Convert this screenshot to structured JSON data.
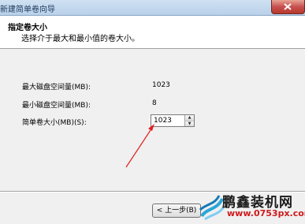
{
  "window": {
    "title": "新建简单卷向导"
  },
  "header": {
    "title": "指定卷大小",
    "subtitle": "选择介于最大和最小值的卷大小。"
  },
  "fields": {
    "max_label": "最大磁盘空间量(MB):",
    "max_value": "1023",
    "min_label": "最小磁盘空间量(MB):",
    "min_value": "8",
    "size_label": "简单卷大小(MB)(S):",
    "size_value": "1023"
  },
  "buttons": {
    "back_label": "< 上一步(B)"
  },
  "watermark": {
    "text": "鹏鑫装机网",
    "url": "www.0753px.com"
  },
  "colors": {
    "arrow": "#e02020",
    "close_button": "#c75050",
    "watermark_url": "#d0191c"
  },
  "icons": {
    "spin_up": "spin-up-arrow",
    "spin_down": "spin-down-arrow",
    "logo": "swirl-logo"
  }
}
